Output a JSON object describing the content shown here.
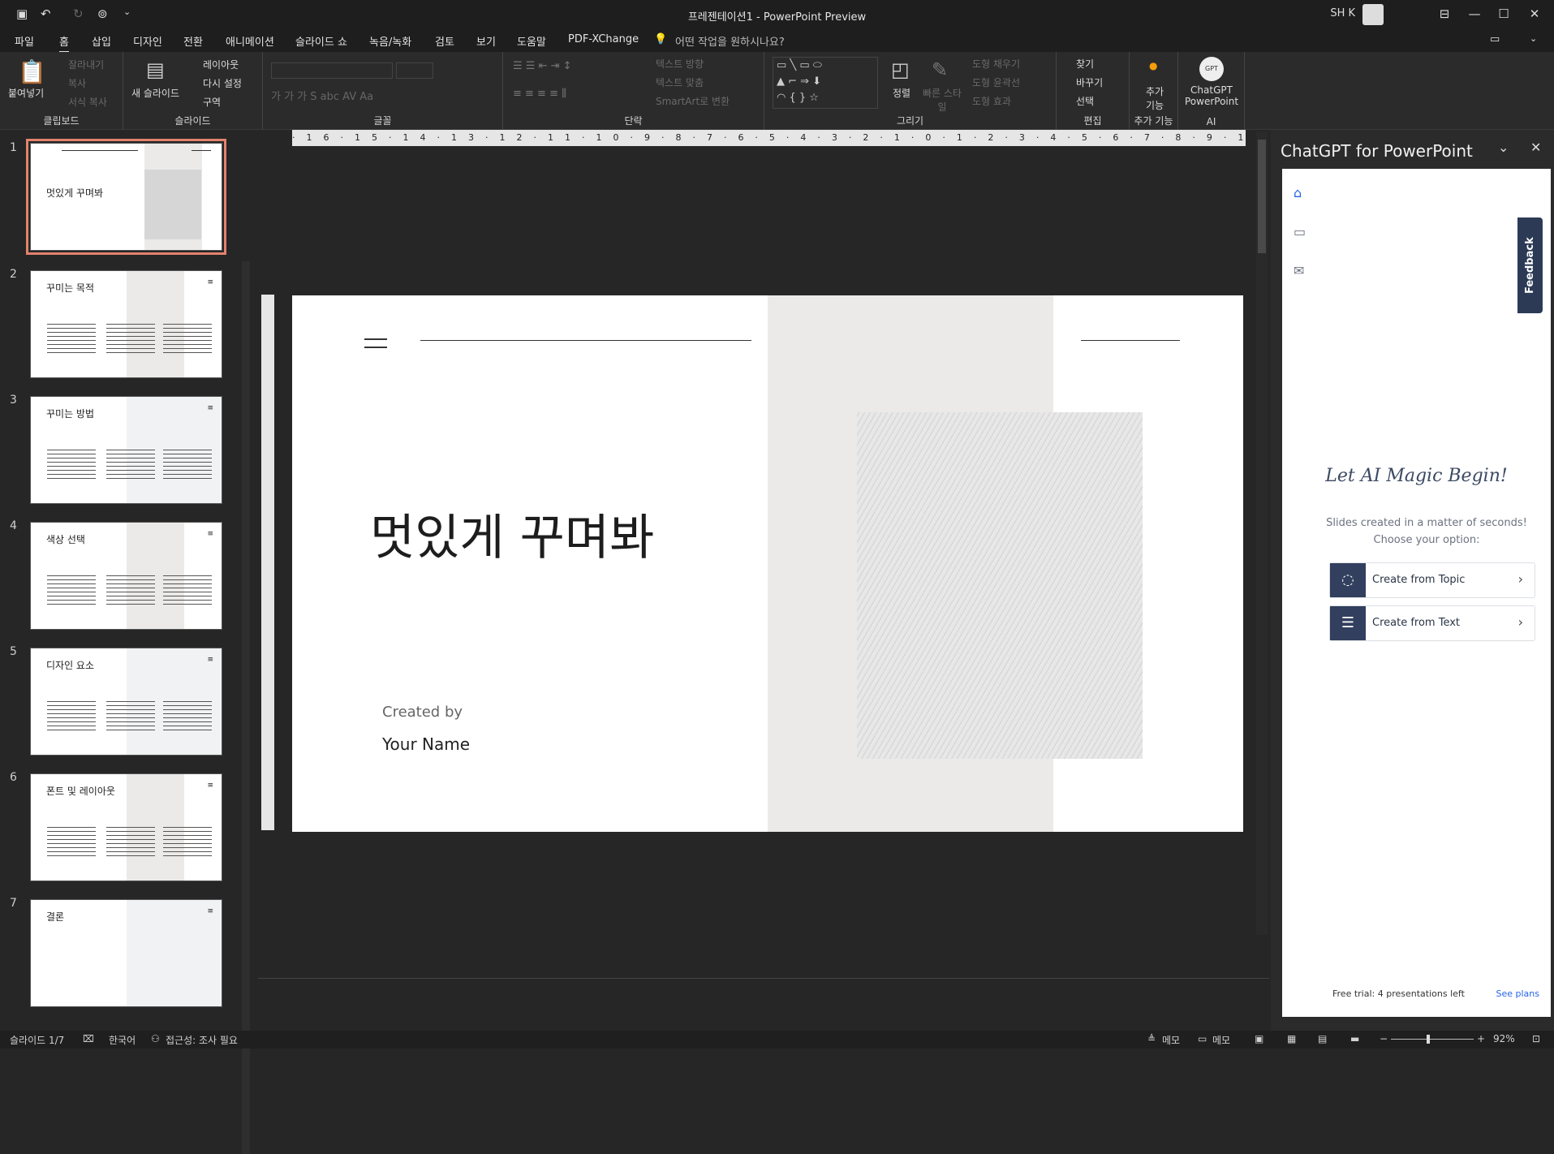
{
  "window": {
    "title": "프레젠테이션1  -  PowerPoint Preview",
    "user": "SH K"
  },
  "menu": [
    "파일",
    "홈",
    "삽입",
    "디자인",
    "전환",
    "애니메이션",
    "슬라이드 쇼",
    "녹음/녹화",
    "검토",
    "보기",
    "도움말",
    "PDF-XChange"
  ],
  "search_hint": "어떤 작업을 원하시나요?",
  "ribbon": {
    "clipboard": {
      "label": "클립보드",
      "paste": "붙여넣기",
      "cut": "잘라내기",
      "copy": "복사",
      "format": "서식 복사"
    },
    "slides": {
      "label": "슬라이드",
      "new": "새 슬라이드",
      "layout": "레이아웃",
      "reset": "다시 설정",
      "section": "구역"
    },
    "font": {
      "label": "글꼴"
    },
    "paragraph": {
      "label": "단락",
      "text_dir": "텍스트 방향",
      "align": "텍스트 맞춤",
      "smartart": "SmartArt로 변환"
    },
    "drawing": {
      "label": "그리기",
      "arrange": "정렬",
      "quick": "빠른 스타일",
      "fill": "도형 채우기",
      "outline": "도형 윤곽선",
      "effect": "도형 효과"
    },
    "editing": {
      "label": "편집",
      "find": "찾기",
      "replace": "바꾸기",
      "select": "선택"
    },
    "addins": {
      "label": "추가 기능",
      "btn": "추가 기능"
    },
    "ai": {
      "label": "AI",
      "btn": "ChatGPT PowerPoint",
      "logo": "GPT"
    }
  },
  "thumbs": [
    {
      "num": "1",
      "title": "멋있게 꾸며봐"
    },
    {
      "num": "2",
      "title": "꾸미는 목적"
    },
    {
      "num": "3",
      "title": "꾸미는 방법"
    },
    {
      "num": "4",
      "title": "색상 선택"
    },
    {
      "num": "5",
      "title": "디자인 요소"
    },
    {
      "num": "6",
      "title": "폰트 및 레이아웃"
    },
    {
      "num": "7",
      "title": "결론"
    }
  ],
  "slide": {
    "title": "멋있게 꾸며봐",
    "created_by": "Created by",
    "name": "Your Name"
  },
  "panel": {
    "title": "ChatGPT for PowerPoint",
    "magic": "Let AI Magic Begin!",
    "sub": "Slides created in a matter of seconds! Choose your option:",
    "opt1": "Create from Topic",
    "opt2": "Create from Text",
    "feedback": "Feedback",
    "trial": "Free trial: 4 presentations left",
    "plans": "See plans"
  },
  "status": {
    "slide": "슬라이드 1/7",
    "lang": "한국어",
    "access": "접근성: 조사 필요",
    "notes": "메모",
    "comments": "메모",
    "zoom": "92%"
  }
}
